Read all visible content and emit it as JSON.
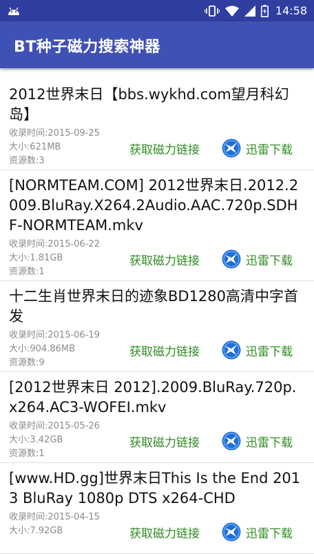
{
  "status_bar": {
    "time": "14:58",
    "icons": [
      "android-icon",
      "vibrate-icon",
      "wifi-icon",
      "signal-icon",
      "battery-icon"
    ]
  },
  "app_bar": {
    "title": "BT种子磁力搜索神器"
  },
  "colors": {
    "status_bar": "#303f9f",
    "app_bar": "#3f51b5",
    "action_green": "#2e8b20",
    "meta_gray": "#8a8a8a",
    "thunder_blue": "#1e6fd9"
  },
  "results": [
    {
      "title": "2012世界末日【bbs.wykhd.com望月科幻岛】",
      "date": "收录时间:2015-09-25",
      "size": "大小:621MB",
      "sources": "资源数:3",
      "magnet_label": "获取磁力链接",
      "thunder_label": "迅雷下载"
    },
    {
      "title": "[NORMTEAM.COM] 2012世界末日.2012.2009.BluRay.X264.2Audio.AAC.720p.SDHF-NORMTEAM.mkv",
      "date": "收录时间:2015-06-22",
      "size": "大小:1.81GB",
      "sources": "资源数:1",
      "magnet_label": "获取磁力链接",
      "thunder_label": "迅雷下载"
    },
    {
      "title": "十二生肖世界末日的迹象BD1280高清中字首发",
      "date": "收录时间:2015-06-19",
      "size": "大小:904.86MB",
      "sources": "资源数:9",
      "magnet_label": "获取磁力链接",
      "thunder_label": "迅雷下载"
    },
    {
      "title": "[2012世界末日 2012].2009.BluRay.720p.x264.AC3-WOFEI.mkv",
      "date": "收录时间:2015-05-26",
      "size": "大小:3.42GB",
      "sources": "资源数:1",
      "magnet_label": "获取磁力链接",
      "thunder_label": "迅雷下载"
    },
    {
      "title": "[www.HD.gg]世界末日This Is the End 2013 BluRay 1080p DTS x264-CHD",
      "date": "收录时间:2015-04-15",
      "size": "大小:7.92GB",
      "sources": "",
      "magnet_label": "获取磁力链接",
      "thunder_label": "迅雷下载"
    }
  ]
}
